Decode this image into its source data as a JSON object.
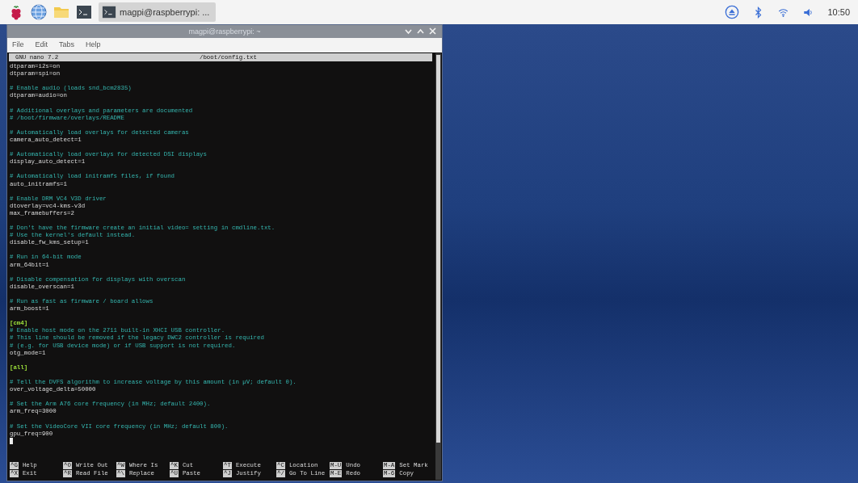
{
  "taskbar": {
    "launchers": [
      {
        "kind": "raspberry"
      },
      {
        "kind": "globe"
      },
      {
        "kind": "folder"
      },
      {
        "kind": "terminal"
      }
    ],
    "tasks": [
      {
        "label": "magpi@raspberrypi: ...",
        "selected": true
      }
    ],
    "tray": [
      {
        "kind": "eject"
      },
      {
        "kind": "bluetooth"
      },
      {
        "kind": "wifi"
      },
      {
        "kind": "volume"
      }
    ],
    "clock": "10:50"
  },
  "window": {
    "title": "magpi@raspberrypi: ~",
    "menu": [
      "File",
      "Edit",
      "Tabs",
      "Help"
    ]
  },
  "nano": {
    "version": "GNU nano 7.2",
    "filename": "/boot/config.txt",
    "lines": [
      {
        "kind": "setting",
        "text": "dtparam=i2s=on"
      },
      {
        "kind": "setting",
        "text": "dtparam=spi=on"
      },
      {
        "kind": "blank"
      },
      {
        "kind": "comment",
        "text": "# Enable audio (loads snd_bcm2835)"
      },
      {
        "kind": "setting",
        "text": "dtparam=audio=on"
      },
      {
        "kind": "blank"
      },
      {
        "kind": "comment",
        "text": "# Additional overlays and parameters are documented"
      },
      {
        "kind": "comment",
        "text": "# /boot/firmware/overlays/README"
      },
      {
        "kind": "blank"
      },
      {
        "kind": "comment",
        "text": "# Automatically load overlays for detected cameras"
      },
      {
        "kind": "setting",
        "text": "camera_auto_detect=1"
      },
      {
        "kind": "blank"
      },
      {
        "kind": "comment",
        "text": "# Automatically load overlays for detected DSI displays"
      },
      {
        "kind": "setting",
        "text": "display_auto_detect=1"
      },
      {
        "kind": "blank"
      },
      {
        "kind": "comment",
        "text": "# Automatically load initramfs files, if found"
      },
      {
        "kind": "setting",
        "text": "auto_initramfs=1"
      },
      {
        "kind": "blank"
      },
      {
        "kind": "comment",
        "text": "# Enable DRM VC4 V3D driver"
      },
      {
        "kind": "setting",
        "text": "dtoverlay=vc4-kms-v3d"
      },
      {
        "kind": "setting",
        "text": "max_framebuffers=2"
      },
      {
        "kind": "blank"
      },
      {
        "kind": "comment",
        "text": "# Don't have the firmware create an initial video= setting in cmdline.txt."
      },
      {
        "kind": "comment",
        "text": "# Use the kernel's default instead."
      },
      {
        "kind": "setting",
        "text": "disable_fw_kms_setup=1"
      },
      {
        "kind": "blank"
      },
      {
        "kind": "comment",
        "text": "# Run in 64-bit mode"
      },
      {
        "kind": "setting",
        "text": "arm_64bit=1"
      },
      {
        "kind": "blank"
      },
      {
        "kind": "comment",
        "text": "# Disable compensation for displays with overscan"
      },
      {
        "kind": "setting",
        "text": "disable_overscan=1"
      },
      {
        "kind": "blank"
      },
      {
        "kind": "comment",
        "text": "# Run as fast as firmware / board allows"
      },
      {
        "kind": "setting",
        "text": "arm_boost=1"
      },
      {
        "kind": "blank"
      },
      {
        "kind": "section",
        "text": "[cm4]"
      },
      {
        "kind": "comment",
        "text": "# Enable host mode on the 2711 built-in XHCI USB controller."
      },
      {
        "kind": "comment",
        "text": "# This line should be removed if the legacy DWC2 controller is required"
      },
      {
        "kind": "comment",
        "text": "# (e.g. for USB device mode) or if USB support is not required."
      },
      {
        "kind": "setting",
        "text": "otg_mode=1"
      },
      {
        "kind": "blank"
      },
      {
        "kind": "section",
        "text": "[all]"
      },
      {
        "kind": "blank"
      },
      {
        "kind": "comment",
        "text": "# Tell the DVFS algorithm to increase voltage by this amount (in µV; default 0)."
      },
      {
        "kind": "setting",
        "text": "over_voltage_delta=50000"
      },
      {
        "kind": "blank"
      },
      {
        "kind": "comment",
        "text": "# Set the Arm A76 core frequency (in MHz; default 2400)."
      },
      {
        "kind": "setting",
        "text": "arm_freq=3000"
      },
      {
        "kind": "blank"
      },
      {
        "kind": "comment",
        "text": "# Set the VideoCore VII core frequency (in MHz; default 800)."
      },
      {
        "kind": "setting",
        "text": "gpu_freq=900"
      }
    ],
    "shortcuts": [
      {
        "key": "^G",
        "label": "Help"
      },
      {
        "key": "^X",
        "label": "Exit"
      },
      {
        "key": "^O",
        "label": "Write Out"
      },
      {
        "key": "^R",
        "label": "Read File"
      },
      {
        "key": "^W",
        "label": "Where Is"
      },
      {
        "key": "^\\",
        "label": "Replace"
      },
      {
        "key": "^K",
        "label": "Cut"
      },
      {
        "key": "^U",
        "label": "Paste"
      },
      {
        "key": "^T",
        "label": "Execute"
      },
      {
        "key": "^J",
        "label": "Justify"
      },
      {
        "key": "^C",
        "label": "Location"
      },
      {
        "key": "^/",
        "label": "Go To Line"
      },
      {
        "key": "M-U",
        "label": "Undo"
      },
      {
        "key": "M-E",
        "label": "Redo"
      },
      {
        "key": "M-A",
        "label": "Set Mark"
      },
      {
        "key": "M-6",
        "label": "Copy"
      }
    ]
  }
}
